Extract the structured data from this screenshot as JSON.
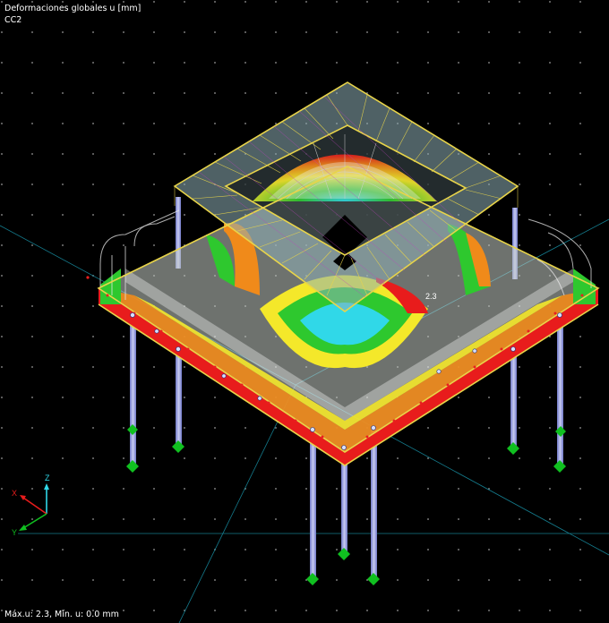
{
  "result_title": "Deformaciones globales u [mm]",
  "load_combination": "CC2",
  "status_text": "Máx.u: 2.3, Mín. u: 0.0 mm",
  "max_label": "2.3",
  "axes": {
    "x": "X",
    "y": "Y",
    "z": "Z"
  },
  "colors": {
    "background": "#000000",
    "grid_dot": "#9a9a9a",
    "guide_line": "#1a9ab0",
    "member": "#e8d44a",
    "column": "#8d93d8",
    "support": "#10c020",
    "contour_max": "#e81c1c",
    "contour_high": "#f08a1a",
    "contour_mid": "#f4e82a",
    "contour_low": "#2ec82e",
    "contour_min": "#30d8e8"
  }
}
